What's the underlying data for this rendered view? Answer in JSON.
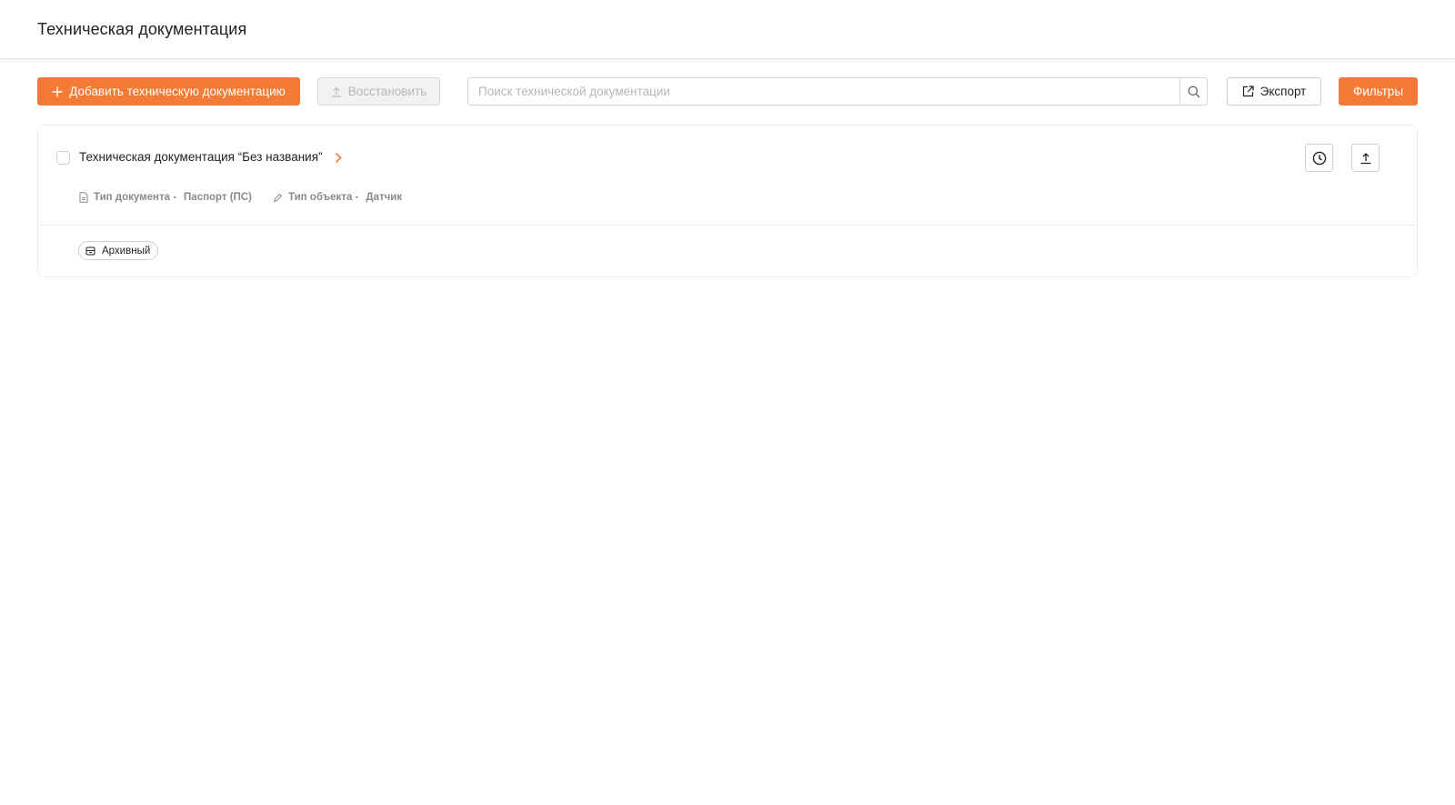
{
  "header": {
    "title": "Техническая документация"
  },
  "toolbar": {
    "add_label": "Добавить техническую документацию",
    "restore_label": "Восстановить",
    "search_placeholder": "Поиск технической документации",
    "export_label": "Экспорт",
    "filters_label": "Фильтры"
  },
  "document": {
    "title": "Техническая документация “Без названия”",
    "doc_type_label": "Тип документа -",
    "doc_type_value": "Паспорт (ПС)",
    "object_type_label": "Тип объекта -",
    "object_type_value": "Датчик",
    "status": "Архивный"
  },
  "colors": {
    "accent": "#f47b35",
    "border": "#cfcfcf",
    "muted_text": "#8a8a8a"
  },
  "icons": [
    "plus-icon",
    "upload-icon",
    "search-icon",
    "external-link-icon",
    "chevron-right-icon",
    "document-icon",
    "pencil-icon",
    "clock-icon",
    "archive-icon"
  ]
}
